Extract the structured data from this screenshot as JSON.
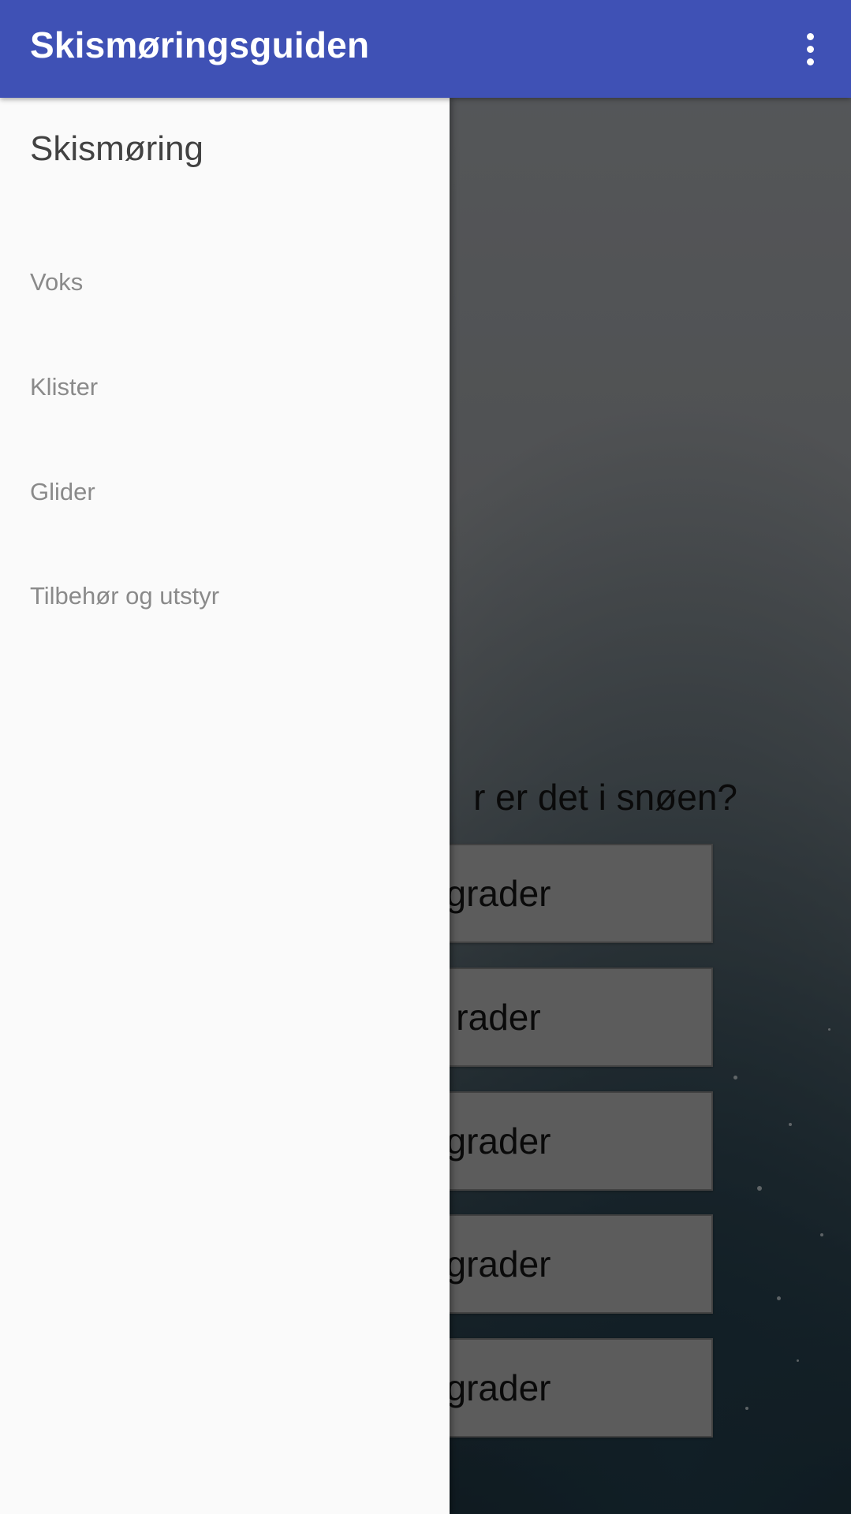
{
  "app_bar": {
    "title": "Skismøringsguiden",
    "overflow_icon": "more-vert-icon",
    "background_color": "#3f51b5"
  },
  "drawer": {
    "header": "Skismøring",
    "items": [
      {
        "label": "Voks"
      },
      {
        "label": "Klister"
      },
      {
        "label": "Glider"
      },
      {
        "label": "Tilbehør og utstyr"
      }
    ]
  },
  "main": {
    "question_visible": "r er det i snøen?",
    "buttons": [
      {
        "label": "grader"
      },
      {
        "label": "rader"
      },
      {
        "label": "grader"
      },
      {
        "label": "grader"
      },
      {
        "label": "grader"
      }
    ]
  }
}
